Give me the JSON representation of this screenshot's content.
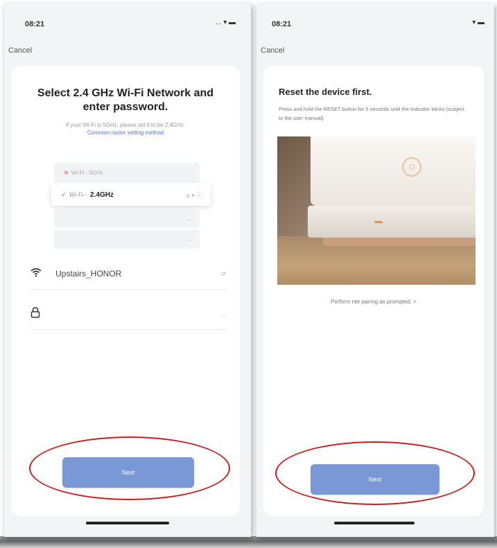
{
  "left": {
    "status_time": "08:21",
    "status_icons": "... ▾ ▬",
    "cancel": "Cancel",
    "title": "Select 2.4 GHz Wi-Fi Network and enter password.",
    "hint": "If your Wi-Fi is 5GHz, please set it to be 2.4GHz.",
    "hint_link": "Common router setting method",
    "networks": [
      {
        "prefix": "✕",
        "name": "Wi-Fi - 5GHz",
        "strong": ""
      },
      {
        "prefix": "✓",
        "name": "Wi-Fi -",
        "strong": "2.4GHz",
        "trail": "a ▾ ⓘ"
      },
      {
        "name": "",
        "trail": "..."
      },
      {
        "name": "",
        "trail": "..."
      }
    ],
    "wifi_name": "Upstairs_HONOR",
    "wifi_trail": "⇄",
    "password_value": "",
    "password_trail": "◡",
    "next": "Next"
  },
  "right": {
    "status_time": "08:21",
    "status_icons": "▾ ▬",
    "cancel": "Cancel",
    "title": "Reset the device first.",
    "body": "Press and hold the RESET button for 5 seconds until the indicator blinks (subject to the user manual).",
    "prompt": "Perform net pairing as prompted. >",
    "next": "Next"
  },
  "colors": {
    "accent_button": "#7a97d6",
    "annotation_red": "#cc1c1c",
    "link_blue": "#4a78d6"
  }
}
